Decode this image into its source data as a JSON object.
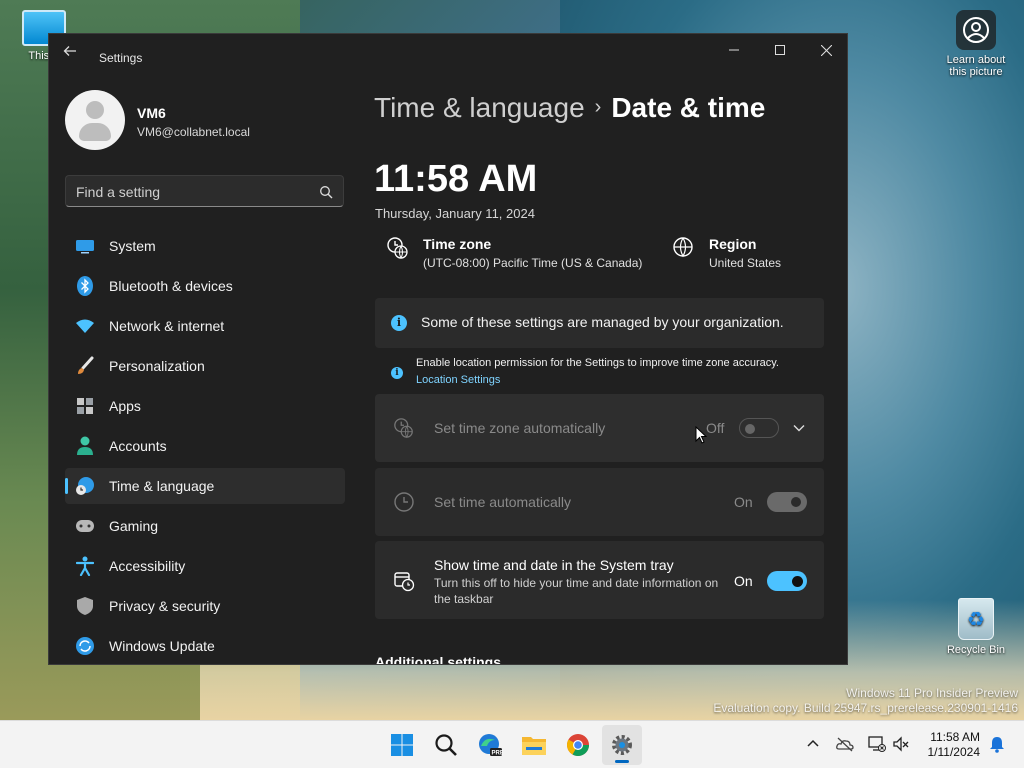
{
  "desktop": {
    "icons": [
      {
        "label": "This P"
      },
      {
        "label": "Learn about this picture"
      },
      {
        "label": "Recycle Bin"
      }
    ],
    "watermark": {
      "line1": "Windows 11 Pro Insider Preview",
      "line2": "Evaluation copy. Build 25947.rs_prerelease.230901-1416"
    }
  },
  "window": {
    "title": "Settings",
    "user": {
      "name": "VM6",
      "email": "VM6@collabnet.local"
    },
    "search": {
      "placeholder": "Find a setting"
    },
    "nav": [
      {
        "label": "System",
        "icon": "monitor-icon"
      },
      {
        "label": "Bluetooth & devices",
        "icon": "bluetooth-icon"
      },
      {
        "label": "Network & internet",
        "icon": "wifi-icon"
      },
      {
        "label": "Personalization",
        "icon": "brush-icon"
      },
      {
        "label": "Apps",
        "icon": "apps-icon"
      },
      {
        "label": "Accounts",
        "icon": "person-icon"
      },
      {
        "label": "Time & language",
        "icon": "globe-clock-icon",
        "active": true
      },
      {
        "label": "Gaming",
        "icon": "gamepad-icon"
      },
      {
        "label": "Accessibility",
        "icon": "accessibility-icon"
      },
      {
        "label": "Privacy & security",
        "icon": "shield-icon"
      },
      {
        "label": "Windows Update",
        "icon": "update-icon"
      }
    ],
    "breadcrumb": {
      "parent": "Time & language",
      "separator": "›",
      "current": "Date & time"
    },
    "clock": {
      "time": "11:58 AM",
      "date": "Thursday, January 11, 2024"
    },
    "time_zone": {
      "title": "Time zone",
      "value": "(UTC-08:00) Pacific Time (US & Canada)"
    },
    "region": {
      "title": "Region",
      "value": "United States"
    },
    "managed_banner": "Some of these settings are managed by your organization.",
    "location_note": {
      "text": "Enable location permission for the Settings to improve time zone accuracy.",
      "link": "Location Settings"
    },
    "settings": {
      "tz_auto": {
        "label": "Set time zone automatically",
        "state": "Off",
        "on": false,
        "disabled": true
      },
      "time_auto": {
        "label": "Set time automatically",
        "state": "On",
        "on": true,
        "disabled": true
      },
      "tray": {
        "label": "Show time and date in the System tray",
        "sub": "Turn this off to hide your time and date information on the taskbar",
        "state": "On",
        "on": true,
        "disabled": false
      }
    },
    "additional_heading": "Additional settings"
  },
  "taskbar": {
    "time": "11:58 AM",
    "date": "1/11/2024",
    "accent": "#0067c0"
  },
  "colors": {
    "accent": "#4cc2ff",
    "window_bg": "#202020",
    "card_bg": "#2b2b2b"
  }
}
